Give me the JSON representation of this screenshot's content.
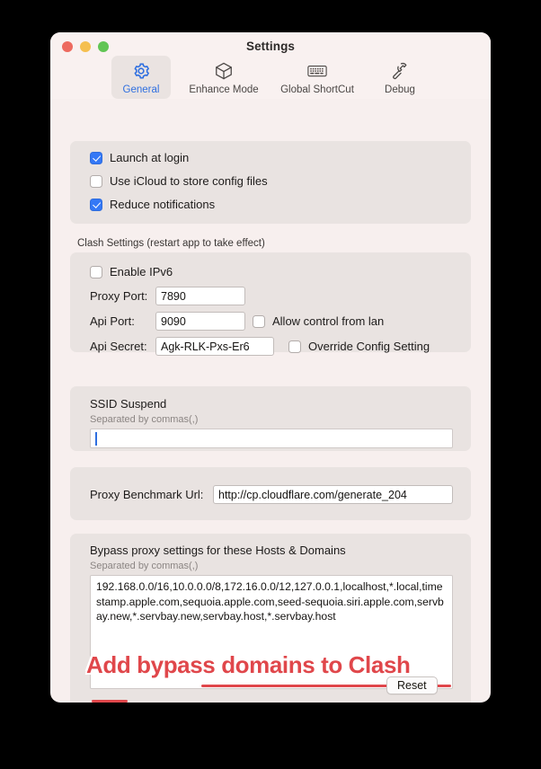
{
  "window": {
    "title": "Settings",
    "traffic_lights": [
      {
        "name": "close",
        "color": "#ed6a5f"
      },
      {
        "name": "minimize",
        "color": "#f5bf4f"
      },
      {
        "name": "zoom",
        "color": "#61c554"
      }
    ]
  },
  "toolbar": {
    "tabs": [
      {
        "label": "General",
        "icon": "gear-icon",
        "active": true
      },
      {
        "label": "Enhance Mode",
        "icon": "cube-icon",
        "active": false
      },
      {
        "label": "Global ShortCut",
        "icon": "keyboard-icon",
        "active": false
      },
      {
        "label": "Debug",
        "icon": "hammer-icon",
        "active": false
      }
    ]
  },
  "general_options": {
    "items": [
      {
        "label": "Launch at login",
        "checked": true
      },
      {
        "label": "Use iCloud to store config files",
        "checked": false
      },
      {
        "label": "Reduce notifications",
        "checked": true
      }
    ]
  },
  "clash_settings": {
    "group_label": "Clash Settings (restart app to take effect)",
    "enable_ipv6": {
      "label": "Enable IPv6",
      "checked": false
    },
    "proxy_port": {
      "label": "Proxy Port:",
      "value": "7890"
    },
    "api_port": {
      "label": "Api Port:",
      "value": "9090"
    },
    "api_secret": {
      "label": "Api Secret:",
      "value": "Agk-RLK-Pxs-Er6"
    },
    "allow_lan": {
      "label": "Allow control from lan",
      "checked": false
    },
    "override_config": {
      "label": "Override Config Setting",
      "checked": false
    }
  },
  "ssid_suspend": {
    "title": "SSID Suspend",
    "note": "Separated by commas(,)",
    "value": "",
    "placeholder": ""
  },
  "benchmark": {
    "label": "Proxy Benchmark Url:",
    "value": "http://cp.cloudflare.com/generate_204"
  },
  "bypass": {
    "title": "Bypass proxy settings for these Hosts & Domains",
    "note": "Separated by commas(,)",
    "value": "192.168.0.0/16,10.0.0.0/8,172.16.0.0/12,127.0.0.1,localhost,*.local,timestamp.apple.com,sequoia.apple.com,seed-sequoia.siri.apple.com,servbay.new,*.servbay.new,servbay.host,*.servbay.host",
    "reset_label": "Reset"
  },
  "annotation": {
    "text": "Add bypass domains to Clash",
    "color": "#e0474b"
  },
  "colors": {
    "window_bg": "#f7efee",
    "titlebar_bg": "#f9f1f0",
    "panel_bg": "#e9e3e1",
    "accent_blue": "#3478f6",
    "tab_active_text": "#2f6fe0",
    "field_bg": "#ffffff",
    "annotation_red": "#e0474b"
  }
}
